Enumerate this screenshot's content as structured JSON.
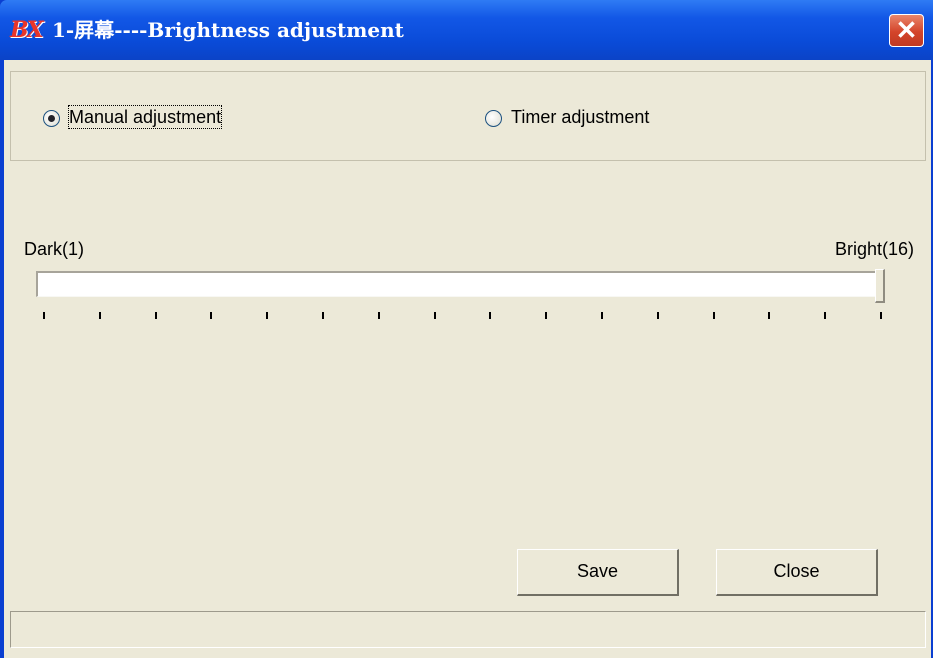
{
  "window": {
    "logo_text": "BX",
    "title": "1-屏幕----Brightness adjustment",
    "close_glyph": "✕"
  },
  "mode": {
    "options": [
      {
        "label": "Manual adjustment",
        "selected": true
      },
      {
        "label": "Timer adjustment",
        "selected": false
      }
    ]
  },
  "slider": {
    "min_label": "Dark(1)",
    "max_label": "Bright(16)",
    "min": 1,
    "max": 16,
    "value": 16
  },
  "buttons": {
    "save_label": "Save",
    "close_label": "Close"
  },
  "statusbar": {
    "text": ""
  },
  "colors": {
    "titlebar": "#0a4bd8",
    "face": "#ece9d8",
    "close_button": "#d4442a"
  },
  "icons": [
    "app-logo-icon",
    "close-icon",
    "radio-checked-icon",
    "radio-unchecked-icon"
  ]
}
